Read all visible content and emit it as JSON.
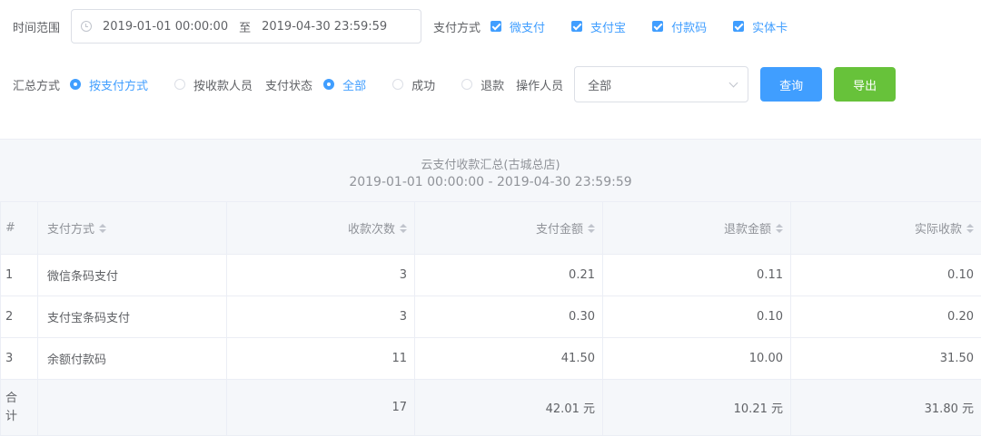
{
  "filters": {
    "time_range_label": "时间范围",
    "start_date": "2019-01-01 00:00:00",
    "range_separator": "至",
    "end_date": "2019-04-30 23:59:59",
    "pay_method_label": "支付方式",
    "pay_methods": [
      {
        "label": "微支付",
        "checked": true
      },
      {
        "label": "支付宝",
        "checked": true
      },
      {
        "label": "付款码",
        "checked": true
      },
      {
        "label": "实体卡",
        "checked": true
      }
    ],
    "summary_label": "汇总方式",
    "summary_options": [
      {
        "label": "按支付方式",
        "selected": true
      },
      {
        "label": "按收款人员",
        "selected": false
      }
    ],
    "status_label": "支付状态",
    "status_options": [
      {
        "label": "全部",
        "selected": true
      },
      {
        "label": "成功",
        "selected": false
      },
      {
        "label": "退款",
        "selected": false
      }
    ],
    "operator_label": "操作人员",
    "operator_value": "全部",
    "query_button": "查询",
    "export_button": "导出"
  },
  "report": {
    "title": "云支付收款汇总(古城总店)",
    "range": "2019-01-01 00:00:00 - 2019-04-30 23:59:59"
  },
  "table": {
    "headers": [
      "#",
      "支付方式",
      "收款次数",
      "支付金额",
      "退款金额",
      "实际收款"
    ],
    "rows": [
      [
        "1",
        "微信条码支付",
        "3",
        "0.21",
        "0.11",
        "0.10"
      ],
      [
        "2",
        "支付宝条码支付",
        "3",
        "0.30",
        "0.10",
        "0.20"
      ],
      [
        "3",
        "余额付款码",
        "11",
        "41.50",
        "10.00",
        "31.50"
      ]
    ],
    "total": [
      "合计",
      "",
      "17",
      "42.01 元",
      "10.21 元",
      "31.80 元"
    ]
  },
  "colors": {
    "primary": "#409eff",
    "success": "#67c23a",
    "border": "#dcdfe6",
    "header_bg": "#f5f7fa"
  }
}
